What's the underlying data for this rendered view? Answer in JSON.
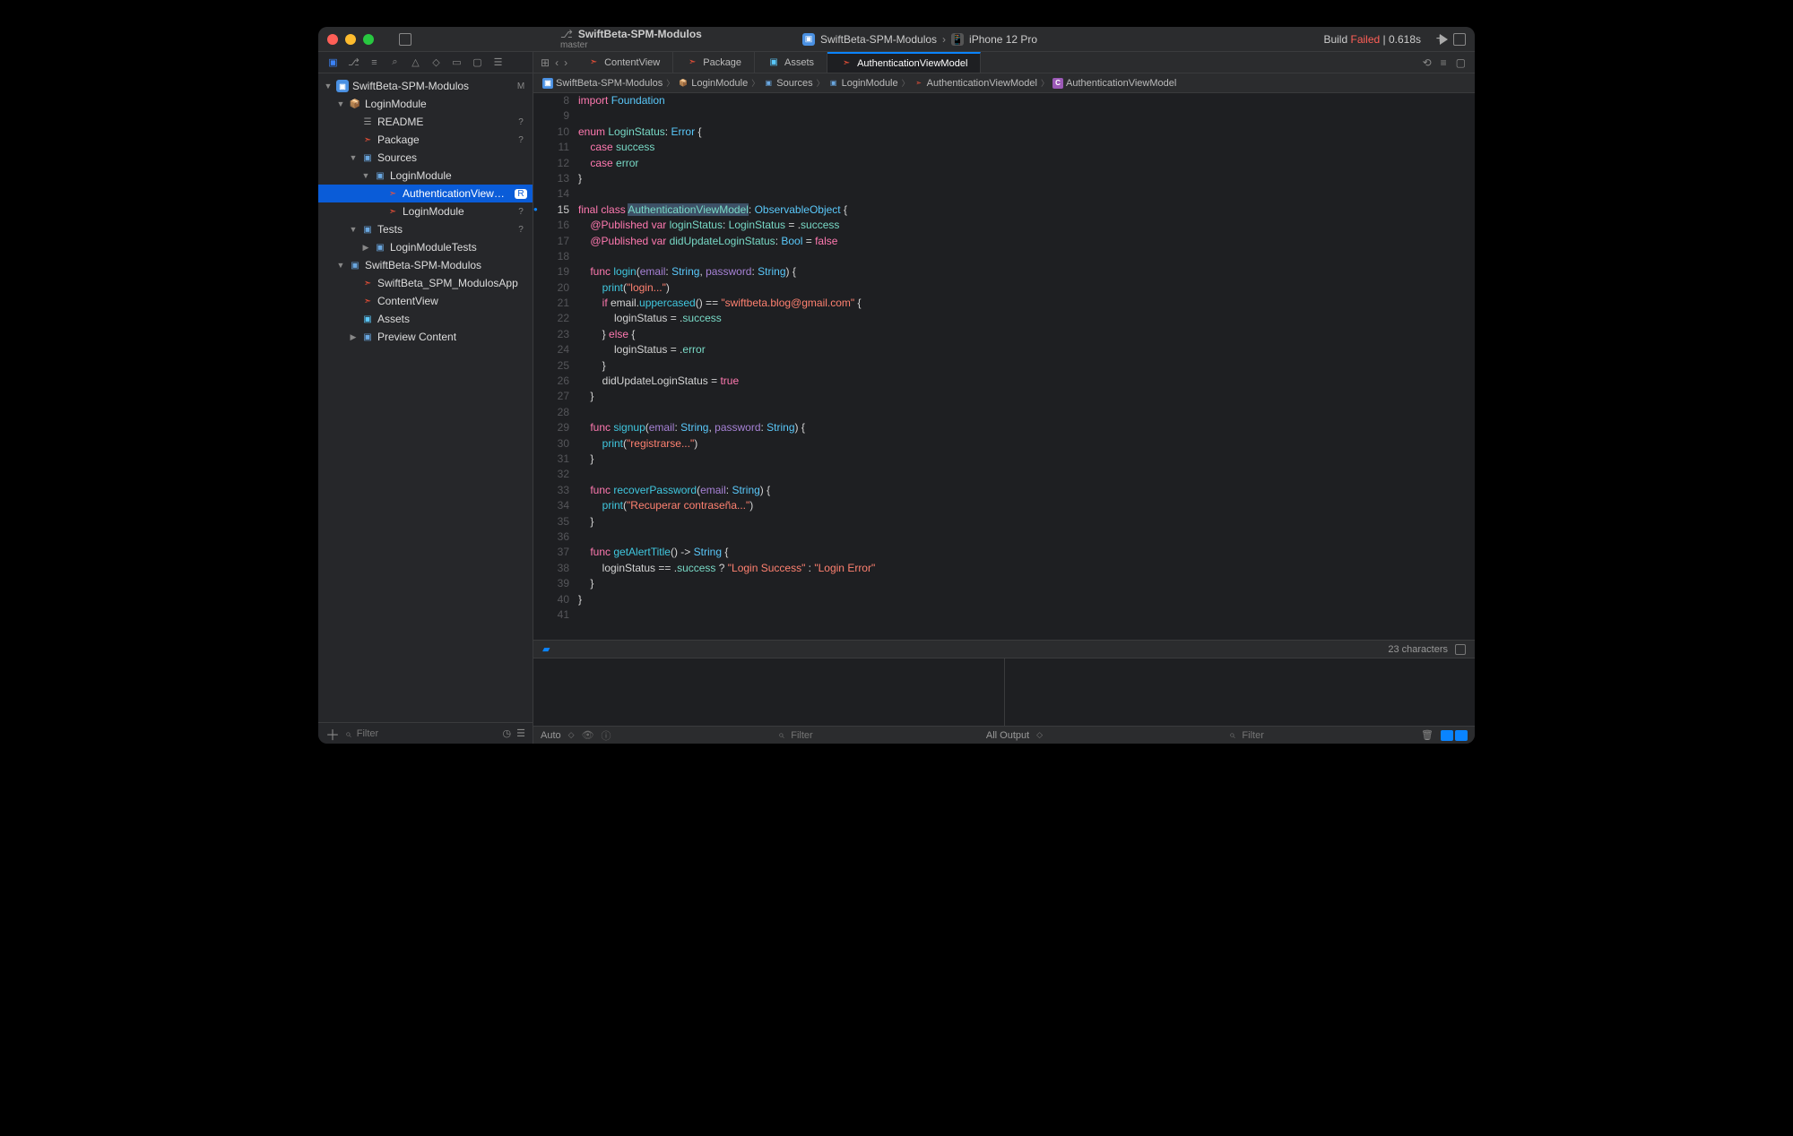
{
  "titlebar": {
    "project": "SwiftBeta-SPM-Modulos",
    "branch": "master",
    "scheme": "SwiftBeta-SPM-Modulos",
    "device": "iPhone 12 Pro",
    "status_prefix": "Build ",
    "status_fail": "Failed",
    "status_suffix": " | 0.618s"
  },
  "navigator": {
    "filter_placeholder": "Filter",
    "items": [
      {
        "indent": 0,
        "disclosure": "open",
        "icon": "proj",
        "iconTxt": "▣",
        "label": "SwiftBeta-SPM-Modulos",
        "badge": "M"
      },
      {
        "indent": 1,
        "disclosure": "open",
        "icon": "pkg",
        "iconTxt": "📦",
        "label": "LoginModule",
        "badge": ""
      },
      {
        "indent": 2,
        "disclosure": "none",
        "icon": "md",
        "iconTxt": "☰",
        "label": "README",
        "badge": "?"
      },
      {
        "indent": 2,
        "disclosure": "none",
        "icon": "swift",
        "iconTxt": "➣",
        "label": "Package",
        "badge": "?"
      },
      {
        "indent": 2,
        "disclosure": "open",
        "icon": "folder",
        "iconTxt": "▣",
        "label": "Sources",
        "badge": ""
      },
      {
        "indent": 3,
        "disclosure": "open",
        "icon": "folder",
        "iconTxt": "▣",
        "label": "LoginModule",
        "badge": ""
      },
      {
        "indent": 4,
        "disclosure": "none",
        "icon": "swift",
        "iconTxt": "➣",
        "label": "AuthenticationViewModel",
        "badge": "R",
        "selected": true
      },
      {
        "indent": 4,
        "disclosure": "none",
        "icon": "swift",
        "iconTxt": "➣",
        "label": "LoginModule",
        "badge": "?"
      },
      {
        "indent": 2,
        "disclosure": "open",
        "icon": "folder",
        "iconTxt": "▣",
        "label": "Tests",
        "badge": "?"
      },
      {
        "indent": 3,
        "disclosure": "closed",
        "icon": "folder",
        "iconTxt": "▣",
        "label": "LoginModuleTests",
        "badge": ""
      },
      {
        "indent": 1,
        "disclosure": "open",
        "icon": "folder",
        "iconTxt": "▣",
        "label": "SwiftBeta-SPM-Modulos",
        "badge": ""
      },
      {
        "indent": 2,
        "disclosure": "none",
        "icon": "swift",
        "iconTxt": "➣",
        "label": "SwiftBeta_SPM_ModulosApp",
        "badge": ""
      },
      {
        "indent": 2,
        "disclosure": "none",
        "icon": "swift",
        "iconTxt": "➣",
        "label": "ContentView",
        "badge": ""
      },
      {
        "indent": 2,
        "disclosure": "none",
        "icon": "assets",
        "iconTxt": "▣",
        "label": "Assets",
        "badge": ""
      },
      {
        "indent": 2,
        "disclosure": "closed",
        "icon": "folder",
        "iconTxt": "▣",
        "label": "Preview Content",
        "badge": ""
      }
    ]
  },
  "tabs": [
    {
      "icon": "swift",
      "label": "ContentView",
      "active": false
    },
    {
      "icon": "swift",
      "label": "Package",
      "active": false
    },
    {
      "icon": "assets",
      "label": "Assets",
      "active": false
    },
    {
      "icon": "swift",
      "label": "AuthenticationViewModel",
      "active": true
    }
  ],
  "jumpbar": [
    {
      "icon": "proj",
      "txt": "▣",
      "label": "SwiftBeta-SPM-Modulos"
    },
    {
      "icon": "pkg",
      "txt": "📦",
      "label": "LoginModule"
    },
    {
      "icon": "folder",
      "txt": "▣",
      "label": "Sources"
    },
    {
      "icon": "folder",
      "txt": "▣",
      "label": "LoginModule"
    },
    {
      "icon": "swift",
      "txt": "➣",
      "label": "AuthenticationViewModel"
    },
    {
      "icon": "class",
      "txt": "C",
      "label": "AuthenticationViewModel"
    }
  ],
  "status": {
    "chars": "23 characters"
  },
  "debug": {
    "auto": "Auto",
    "all_output": "All Output",
    "filter_placeholder": "Filter"
  },
  "code": [
    {
      "n": 8,
      "html": "<span class='kw'>import</span> <span class='type'>Foundation</span>"
    },
    {
      "n": 9,
      "html": ""
    },
    {
      "n": 10,
      "html": "<span class='kw'>enum</span> <span class='typedef'>LoginStatus</span>: <span class='type'>Error</span> {"
    },
    {
      "n": 11,
      "html": "    <span class='kw'>case</span> <span class='prop'>success</span>"
    },
    {
      "n": 12,
      "html": "    <span class='kw'>case</span> <span class='prop'>error</span>"
    },
    {
      "n": 13,
      "html": "}"
    },
    {
      "n": 14,
      "html": ""
    },
    {
      "n": 15,
      "current": true,
      "marker": true,
      "html": "<span class='kw'>final</span> <span class='kw'>class</span> <span class='typedef sel'>AuthenticationViewModel</span>: <span class='type'>ObservableObject</span> {"
    },
    {
      "n": 16,
      "html": "    <span class='kw'>@Published</span> <span class='kw'>var</span> <span class='prop'>loginStatus</span>: <span class='typedef'>LoginStatus</span> = .<span class='prop'>success</span>"
    },
    {
      "n": 17,
      "html": "    <span class='kw'>@Published</span> <span class='kw'>var</span> <span class='prop'>didUpdateLoginStatus</span>: <span class='type'>Bool</span> = <span class='lit'>false</span>"
    },
    {
      "n": 18,
      "html": "    "
    },
    {
      "n": 19,
      "html": "    <span class='kw'>func</span> <span class='fname'>login</span>(<span class='param'>email</span>: <span class='type'>String</span>, <span class='param'>password</span>: <span class='type'>String</span>) {"
    },
    {
      "n": 20,
      "html": "        <span class='fname'>print</span>(<span class='str'>\"login...\"</span>)"
    },
    {
      "n": 21,
      "html": "        <span class='kw'>if</span> email.<span class='fname'>uppercased</span>() == <span class='str'>\"swiftbeta.blog@gmail.com\"</span> {"
    },
    {
      "n": 22,
      "html": "            loginStatus = .<span class='prop'>success</span>"
    },
    {
      "n": 23,
      "html": "        } <span class='kw'>else</span> {"
    },
    {
      "n": 24,
      "html": "            loginStatus = .<span class='prop'>error</span>"
    },
    {
      "n": 25,
      "html": "        }"
    },
    {
      "n": 26,
      "html": "        didUpdateLoginStatus = <span class='lit'>true</span>"
    },
    {
      "n": 27,
      "html": "    }"
    },
    {
      "n": 28,
      "html": "    "
    },
    {
      "n": 29,
      "html": "    <span class='kw'>func</span> <span class='fname'>signup</span>(<span class='param'>email</span>: <span class='type'>String</span>, <span class='param'>password</span>: <span class='type'>String</span>) {"
    },
    {
      "n": 30,
      "html": "        <span class='fname'>print</span>(<span class='str'>\"registrarse...\"</span>)"
    },
    {
      "n": 31,
      "html": "    }"
    },
    {
      "n": 32,
      "html": "    "
    },
    {
      "n": 33,
      "html": "    <span class='kw'>func</span> <span class='fname'>recoverPassword</span>(<span class='param'>email</span>: <span class='type'>String</span>) {"
    },
    {
      "n": 34,
      "html": "        <span class='fname'>print</span>(<span class='str'>\"Recuperar contraseña...\"</span>)"
    },
    {
      "n": 35,
      "html": "    }"
    },
    {
      "n": 36,
      "html": "    "
    },
    {
      "n": 37,
      "html": "    <span class='kw'>func</span> <span class='fname'>getAlertTitle</span>() -> <span class='type'>String</span> {"
    },
    {
      "n": 38,
      "html": "        loginStatus == .<span class='prop'>success</span> ? <span class='str'>\"Login Success\"</span> : <span class='str'>\"Login Error\"</span>"
    },
    {
      "n": 39,
      "html": "    }"
    },
    {
      "n": 40,
      "html": "}"
    },
    {
      "n": 41,
      "html": ""
    }
  ]
}
